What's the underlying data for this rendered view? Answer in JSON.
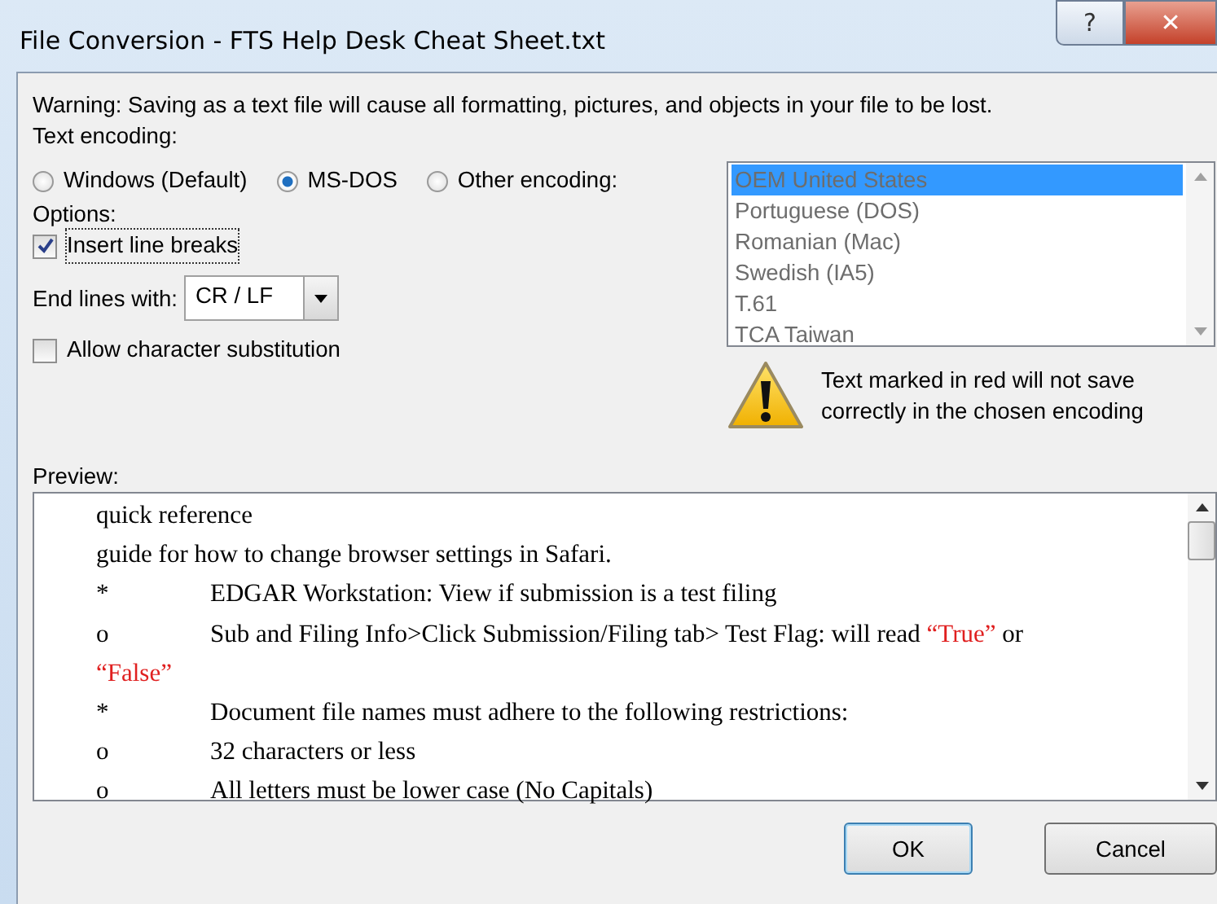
{
  "window": {
    "title": "File Conversion - FTS Help Desk Cheat Sheet.txt",
    "help_button": "?",
    "close_button": "✕"
  },
  "warning": "Warning: Saving as a text file will cause all formatting, pictures, and objects in your file to be lost.",
  "encoding_label": "Text encoding:",
  "encodings": [
    {
      "label": "Windows (Default)",
      "selected": false
    },
    {
      "label": "MS-DOS",
      "selected": true
    },
    {
      "label": "Other encoding:",
      "selected": false
    }
  ],
  "encoding_list": {
    "disabled": true,
    "items": [
      {
        "label": "OEM United States",
        "selected": true
      },
      {
        "label": "Portuguese (DOS)",
        "selected": false
      },
      {
        "label": "Romanian (Mac)",
        "selected": false
      },
      {
        "label": "Swedish (IA5)",
        "selected": false
      },
      {
        "label": "T.61",
        "selected": false
      },
      {
        "label": "TCA Taiwan",
        "selected": false
      }
    ]
  },
  "options_label": "Options:",
  "insert_line_breaks": {
    "label": "Insert line breaks",
    "checked": true
  },
  "end_lines": {
    "label": "End lines with:",
    "value": "CR / LF"
  },
  "allow_substitution": {
    "label": "Allow character substitution",
    "checked": false
  },
  "encoding_notice": "Text marked in red will not save correctly in the chosen encoding",
  "preview_label": "Preview:",
  "preview_lines": [
    {
      "segments": [
        {
          "text": "quick reference",
          "color": "#000000"
        }
      ]
    },
    {
      "segments": [
        {
          "text": "guide for how to change browser settings in Safari.",
          "color": "#000000"
        }
      ]
    },
    {
      "marker": "*",
      "segments": [
        {
          "text": "EDGAR Workstation: View if submission is a test filing",
          "color": "#000000"
        }
      ]
    },
    {
      "marker": "o",
      "segments": [
        {
          "text": "Sub and Filing Info>Click Submission/Filing tab> Test Flag: will read ",
          "color": "#000000"
        },
        {
          "text": "“True”",
          "color": "#e02020"
        },
        {
          "text": " or",
          "color": "#000000"
        }
      ]
    },
    {
      "segments": [
        {
          "text": "“False”",
          "color": "#e02020"
        }
      ]
    },
    {
      "marker": "*",
      "segments": [
        {
          "text": "Document file names must adhere to the following restrictions:",
          "color": "#000000"
        }
      ]
    },
    {
      "marker": "o",
      "segments": [
        {
          "text": "32 characters or less",
          "color": "#000000"
        }
      ]
    },
    {
      "marker": "o",
      "segments": [
        {
          "text": "All letters must be lower case (No Capitals)",
          "color": "#000000"
        }
      ]
    }
  ],
  "buttons": [
    {
      "label": "OK",
      "default": true
    },
    {
      "label": "Cancel",
      "default": false
    }
  ]
}
